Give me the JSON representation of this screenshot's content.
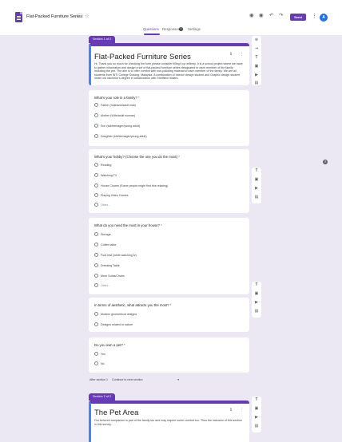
{
  "header": {
    "title": "Flat-Packed Furniture Series",
    "send_label": "Send",
    "avatar_initial": "A",
    "tabs": [
      "Questions",
      "Responses",
      "Settings"
    ],
    "responses_count": "0"
  },
  "section1": {
    "tag": "Section 1 of 2",
    "title": "Flat-Packed Furniture Series",
    "description": "Hi, Thank you so much for checking the form please consider filling it up entirely. It is a school project where we have to gather information and design a set of flat-packed furniture series designated to each member of the family including the pet. The aim is to offer comfort with non-polluting material to each member of the family. We are all students from INTI College Subang, Malaysia. A combination of Interior design student and Graphic design student under our bachelor's degree in collaboration with Sheffield Hallam."
  },
  "questions": [
    {
      "title": "What's your role in a family?",
      "required": "*",
      "options": [
        "Father (husband/adult man)",
        "Mother (Wife/adult woman)",
        "Son (kid/teenager/young adult)",
        "Daughter (kid/teenager/young adult)"
      ]
    },
    {
      "title": "What's your hobby? (Choose the one you do the most)",
      "required": "*",
      "options": [
        "Reading",
        "Watching TV",
        "House Chores (Some people might find this relaxing)",
        "Playing Video Games",
        "Other..."
      ]
    },
    {
      "title": "What do you need the most in your house?",
      "required": "*",
      "options": [
        "Storage",
        "Coffee table",
        "Foot rest (while watching tv)",
        "Dressing Table",
        "More Sofas/Chairs",
        "Other..."
      ]
    },
    {
      "title": "In terms of aesthetic, what attracts you the most?",
      "required": "*",
      "options": [
        "Modern geometrical designs",
        "Designs related to nature"
      ]
    },
    {
      "title": "Do you own a pet?",
      "required": "*",
      "options": [
        "Yes",
        "No"
      ]
    }
  ],
  "after_section": {
    "label": "After section 1",
    "value": "Continue to next section"
  },
  "section2": {
    "tag": "Section 2 of 2",
    "title": "The Pet Area",
    "description": "Our beloved companion is part of the family too and may require some comfort too. Thus the inclusion of this section in this survey."
  }
}
